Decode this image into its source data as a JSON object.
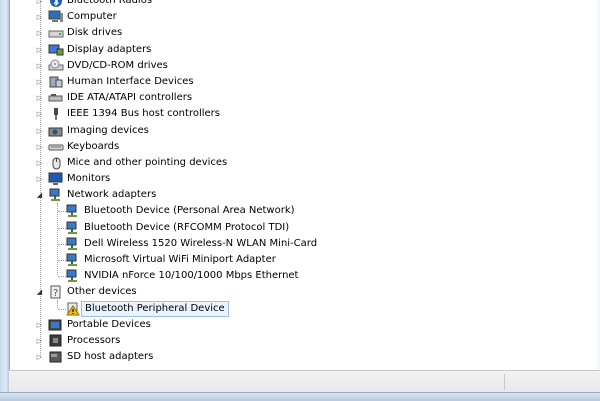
{
  "tree": {
    "categories": [
      {
        "label": "Bluetooth Radios",
        "icon": "bluetooth-icon"
      },
      {
        "label": "Computer",
        "icon": "computer-icon"
      },
      {
        "label": "Disk drives",
        "icon": "disk-drive-icon"
      },
      {
        "label": "Display adapters",
        "icon": "display-adapter-icon"
      },
      {
        "label": "DVD/CD-ROM drives",
        "icon": "dvd-drive-icon"
      },
      {
        "label": "Human Interface Devices",
        "icon": "hid-icon"
      },
      {
        "label": "IDE ATA/ATAPI controllers",
        "icon": "ide-controller-icon"
      },
      {
        "label": "IEEE 1394 Bus host controllers",
        "icon": "firewire-icon"
      },
      {
        "label": "Imaging devices",
        "icon": "camera-icon"
      },
      {
        "label": "Keyboards",
        "icon": "keyboard-icon"
      },
      {
        "label": "Mice and other pointing devices",
        "icon": "mouse-icon"
      },
      {
        "label": "Monitors",
        "icon": "monitor-icon"
      },
      {
        "label": "Network adapters",
        "icon": "network-adapter-icon"
      },
      {
        "label": "Other devices",
        "icon": "other-devices-icon"
      },
      {
        "label": "Portable Devices",
        "icon": "portable-device-icon"
      },
      {
        "label": "Processors",
        "icon": "processor-icon"
      },
      {
        "label": "SD host adapters",
        "icon": "sd-adapter-icon"
      }
    ],
    "network_children": [
      "Bluetooth Device (Personal Area Network)",
      "Bluetooth Device (RFCOMM Protocol TDI)",
      "Dell Wireless 1520 Wireless-N WLAN Mini-Card",
      "Microsoft Virtual WiFi Miniport Adapter",
      "NVIDIA nForce 10/100/1000 Mbps Ethernet"
    ],
    "other_children": [
      "Bluetooth Peripheral Device"
    ],
    "expanded_glyph": "◢",
    "collapsed_glyph": "▷"
  },
  "colors": {
    "selection_border": "#99c2ef",
    "selection_fill": "#eaf3fd",
    "warning": "#f2c200"
  }
}
